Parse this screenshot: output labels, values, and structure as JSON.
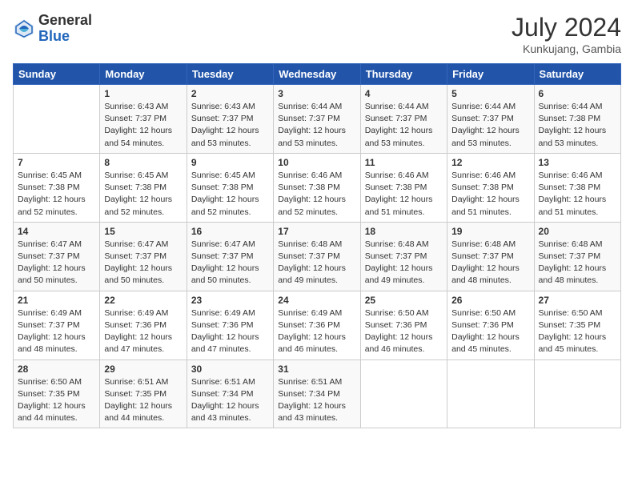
{
  "header": {
    "logo_general": "General",
    "logo_blue": "Blue",
    "month_year": "July 2024",
    "location": "Kunkujang, Gambia"
  },
  "days_of_week": [
    "Sunday",
    "Monday",
    "Tuesday",
    "Wednesday",
    "Thursday",
    "Friday",
    "Saturday"
  ],
  "weeks": [
    [
      {
        "day": "",
        "sunrise": "",
        "sunset": "",
        "daylight": ""
      },
      {
        "day": "1",
        "sunrise": "6:43 AM",
        "sunset": "7:37 PM",
        "daylight": "12 hours and 54 minutes."
      },
      {
        "day": "2",
        "sunrise": "6:43 AM",
        "sunset": "7:37 PM",
        "daylight": "12 hours and 53 minutes."
      },
      {
        "day": "3",
        "sunrise": "6:44 AM",
        "sunset": "7:37 PM",
        "daylight": "12 hours and 53 minutes."
      },
      {
        "day": "4",
        "sunrise": "6:44 AM",
        "sunset": "7:37 PM",
        "daylight": "12 hours and 53 minutes."
      },
      {
        "day": "5",
        "sunrise": "6:44 AM",
        "sunset": "7:37 PM",
        "daylight": "12 hours and 53 minutes."
      },
      {
        "day": "6",
        "sunrise": "6:44 AM",
        "sunset": "7:38 PM",
        "daylight": "12 hours and 53 minutes."
      }
    ],
    [
      {
        "day": "7",
        "sunrise": "6:45 AM",
        "sunset": "7:38 PM",
        "daylight": "12 hours and 52 minutes."
      },
      {
        "day": "8",
        "sunrise": "6:45 AM",
        "sunset": "7:38 PM",
        "daylight": "12 hours and 52 minutes."
      },
      {
        "day": "9",
        "sunrise": "6:45 AM",
        "sunset": "7:38 PM",
        "daylight": "12 hours and 52 minutes."
      },
      {
        "day": "10",
        "sunrise": "6:46 AM",
        "sunset": "7:38 PM",
        "daylight": "12 hours and 52 minutes."
      },
      {
        "day": "11",
        "sunrise": "6:46 AM",
        "sunset": "7:38 PM",
        "daylight": "12 hours and 51 minutes."
      },
      {
        "day": "12",
        "sunrise": "6:46 AM",
        "sunset": "7:38 PM",
        "daylight": "12 hours and 51 minutes."
      },
      {
        "day": "13",
        "sunrise": "6:46 AM",
        "sunset": "7:38 PM",
        "daylight": "12 hours and 51 minutes."
      }
    ],
    [
      {
        "day": "14",
        "sunrise": "6:47 AM",
        "sunset": "7:37 PM",
        "daylight": "12 hours and 50 minutes."
      },
      {
        "day": "15",
        "sunrise": "6:47 AM",
        "sunset": "7:37 PM",
        "daylight": "12 hours and 50 minutes."
      },
      {
        "day": "16",
        "sunrise": "6:47 AM",
        "sunset": "7:37 PM",
        "daylight": "12 hours and 50 minutes."
      },
      {
        "day": "17",
        "sunrise": "6:48 AM",
        "sunset": "7:37 PM",
        "daylight": "12 hours and 49 minutes."
      },
      {
        "day": "18",
        "sunrise": "6:48 AM",
        "sunset": "7:37 PM",
        "daylight": "12 hours and 49 minutes."
      },
      {
        "day": "19",
        "sunrise": "6:48 AM",
        "sunset": "7:37 PM",
        "daylight": "12 hours and 48 minutes."
      },
      {
        "day": "20",
        "sunrise": "6:48 AM",
        "sunset": "7:37 PM",
        "daylight": "12 hours and 48 minutes."
      }
    ],
    [
      {
        "day": "21",
        "sunrise": "6:49 AM",
        "sunset": "7:37 PM",
        "daylight": "12 hours and 48 minutes."
      },
      {
        "day": "22",
        "sunrise": "6:49 AM",
        "sunset": "7:36 PM",
        "daylight": "12 hours and 47 minutes."
      },
      {
        "day": "23",
        "sunrise": "6:49 AM",
        "sunset": "7:36 PM",
        "daylight": "12 hours and 47 minutes."
      },
      {
        "day": "24",
        "sunrise": "6:49 AM",
        "sunset": "7:36 PM",
        "daylight": "12 hours and 46 minutes."
      },
      {
        "day": "25",
        "sunrise": "6:50 AM",
        "sunset": "7:36 PM",
        "daylight": "12 hours and 46 minutes."
      },
      {
        "day": "26",
        "sunrise": "6:50 AM",
        "sunset": "7:36 PM",
        "daylight": "12 hours and 45 minutes."
      },
      {
        "day": "27",
        "sunrise": "6:50 AM",
        "sunset": "7:35 PM",
        "daylight": "12 hours and 45 minutes."
      }
    ],
    [
      {
        "day": "28",
        "sunrise": "6:50 AM",
        "sunset": "7:35 PM",
        "daylight": "12 hours and 44 minutes."
      },
      {
        "day": "29",
        "sunrise": "6:51 AM",
        "sunset": "7:35 PM",
        "daylight": "12 hours and 44 minutes."
      },
      {
        "day": "30",
        "sunrise": "6:51 AM",
        "sunset": "7:34 PM",
        "daylight": "12 hours and 43 minutes."
      },
      {
        "day": "31",
        "sunrise": "6:51 AM",
        "sunset": "7:34 PM",
        "daylight": "12 hours and 43 minutes."
      },
      {
        "day": "",
        "sunrise": "",
        "sunset": "",
        "daylight": ""
      },
      {
        "day": "",
        "sunrise": "",
        "sunset": "",
        "daylight": ""
      },
      {
        "day": "",
        "sunrise": "",
        "sunset": "",
        "daylight": ""
      }
    ]
  ]
}
